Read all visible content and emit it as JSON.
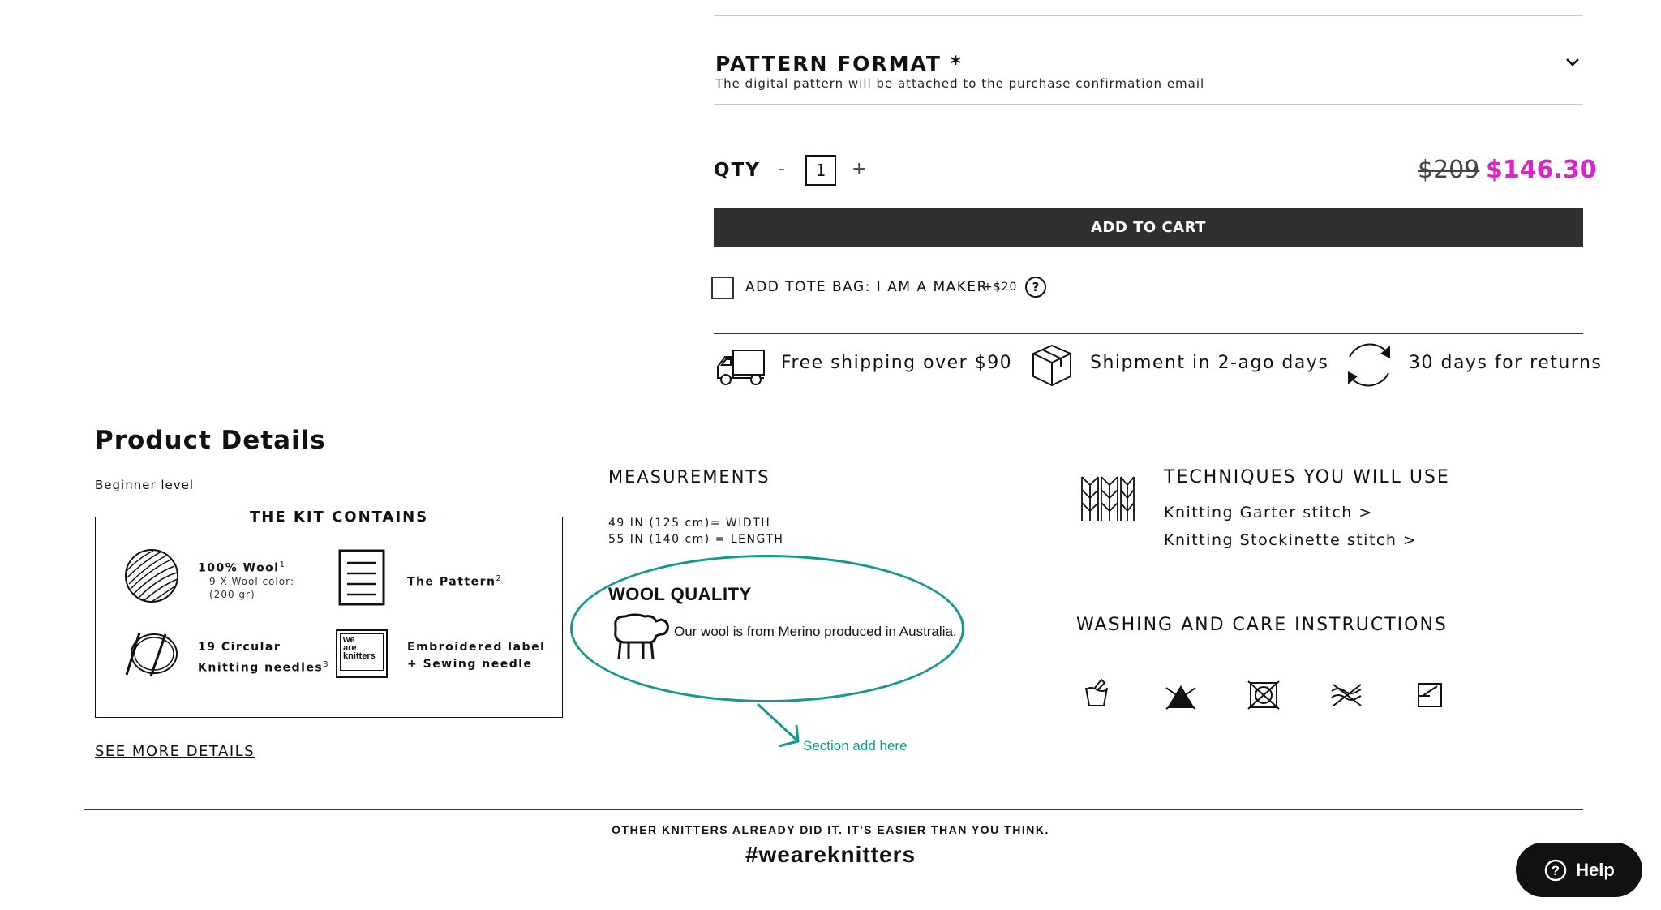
{
  "pattern_format": {
    "title": "PATTERN FORMAT *",
    "subtitle": "The digital pattern will be attached to the purchase confirmation email"
  },
  "purchase": {
    "qty_label": "QTY",
    "minus": "-",
    "plus": "+",
    "qty_value": "1",
    "price_old": "$209",
    "price_new": "$146.30",
    "add_to_cart": "ADD TO CART",
    "accent_color": "#e023c8"
  },
  "tote": {
    "label": "ADD TOTE BAG: I AM A MAKER",
    "price": "+$20",
    "help": "?"
  },
  "perks": [
    {
      "icon": "truck-icon",
      "text": "Free shipping over $90"
    },
    {
      "icon": "box-icon",
      "text": "Shipment in 2-ago days"
    },
    {
      "icon": "returns-icon",
      "text": "30 days for returns"
    }
  ],
  "product_details": {
    "title": "Product Details",
    "level": "Beginner level",
    "kit_heading": "THE KIT CONTAINS",
    "kit_items": [
      {
        "icon": "yarn-ball-icon",
        "name": "100% Wool",
        "sup": "1",
        "sub": "9 X Wool color: (200 gr)"
      },
      {
        "icon": "pattern-document-icon",
        "name": "The Pattern",
        "sup": "2",
        "sub": ""
      },
      {
        "icon": "circular-needles-icon",
        "name_line1": "19 Circular",
        "name_line2": "Knitting needles",
        "sup": "3"
      },
      {
        "icon": "label-icon",
        "name_line1": "Embroidered label",
        "name_line2": "+ Sewing needle"
      }
    ],
    "label_logo_text": [
      "we",
      "are",
      "knitters"
    ],
    "see_more": "SEE MORE DETAILS"
  },
  "measurements": {
    "title": "MEASUREMENTS",
    "lines": [
      "49 IN (125 cm)= WIDTH",
      "55 IN (140 cm) = LENGTH"
    ]
  },
  "wool_quality": {
    "title": "WOOL QUALITY",
    "text": "Our wool is from Merino produced in Australia.",
    "annotation": "Section add here",
    "annotation_color": "#139a90"
  },
  "techniques": {
    "title": "TECHNIQUES YOU WILL USE",
    "links": [
      "Knitting Garter stitch >",
      "Knitting Stockinette stitch >"
    ]
  },
  "washing": {
    "title": "WASHING AND CARE INSTRUCTIONS",
    "icons": [
      "hand-wash-icon",
      "no-bleach-icon",
      "no-tumble-dry-icon",
      "no-dry-clean-icon",
      "dry-flat-icon"
    ]
  },
  "footer": {
    "subtitle": "OTHER KNITTERS ALREADY DID IT. IT'S EASIER THAN YOU THINK.",
    "hashtag": "#weareknitters"
  },
  "help_button": {
    "label": "Help"
  }
}
